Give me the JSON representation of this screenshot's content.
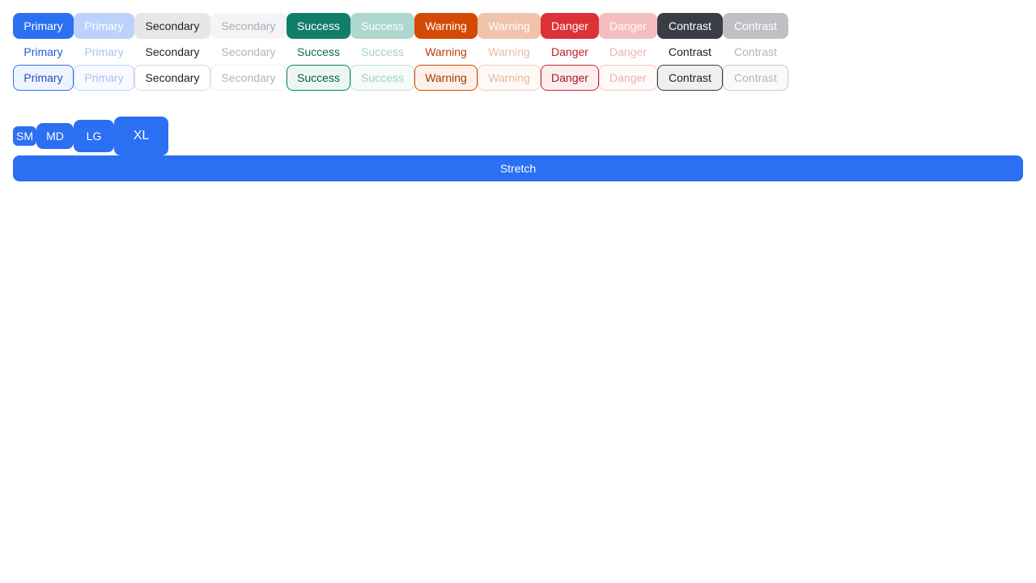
{
  "rows": {
    "filled": [
      {
        "label": "Primary",
        "variant": "primary",
        "disabled": false
      },
      {
        "label": "Primary",
        "variant": "primary",
        "disabled": true
      },
      {
        "label": "Secondary",
        "variant": "secondary",
        "disabled": false
      },
      {
        "label": "Secondary",
        "variant": "secondary",
        "disabled": true
      },
      {
        "label": "Success",
        "variant": "success",
        "disabled": false
      },
      {
        "label": "Success",
        "variant": "success",
        "disabled": true
      },
      {
        "label": "Warning",
        "variant": "warning",
        "disabled": false
      },
      {
        "label": "Warning",
        "variant": "warning",
        "disabled": true
      },
      {
        "label": "Danger",
        "variant": "danger",
        "disabled": false
      },
      {
        "label": "Danger",
        "variant": "danger",
        "disabled": true
      },
      {
        "label": "Contrast",
        "variant": "contrast",
        "disabled": false
      },
      {
        "label": "Contrast",
        "variant": "contrast",
        "disabled": true
      }
    ],
    "ghost": [
      {
        "label": "Primary",
        "variant": "primary",
        "disabled": false
      },
      {
        "label": "Primary",
        "variant": "primary",
        "disabled": true
      },
      {
        "label": "Secondary",
        "variant": "secondary",
        "disabled": false
      },
      {
        "label": "Secondary",
        "variant": "secondary",
        "disabled": true
      },
      {
        "label": "Success",
        "variant": "success",
        "disabled": false
      },
      {
        "label": "Success",
        "variant": "success",
        "disabled": true
      },
      {
        "label": "Warning",
        "variant": "warning",
        "disabled": false
      },
      {
        "label": "Warning",
        "variant": "warning",
        "disabled": true
      },
      {
        "label": "Danger",
        "variant": "danger",
        "disabled": false
      },
      {
        "label": "Danger",
        "variant": "danger",
        "disabled": true
      },
      {
        "label": "Contrast",
        "variant": "contrast",
        "disabled": false
      },
      {
        "label": "Contrast",
        "variant": "contrast",
        "disabled": true
      }
    ],
    "outline": [
      {
        "label": "Primary",
        "variant": "primary",
        "disabled": false
      },
      {
        "label": "Primary",
        "variant": "primary",
        "disabled": true
      },
      {
        "label": "Secondary",
        "variant": "secondary",
        "disabled": false
      },
      {
        "label": "Secondary",
        "variant": "secondary",
        "disabled": true
      },
      {
        "label": "Success",
        "variant": "success",
        "disabled": false
      },
      {
        "label": "Success",
        "variant": "success",
        "disabled": true
      },
      {
        "label": "Warning",
        "variant": "warning",
        "disabled": false
      },
      {
        "label": "Warning",
        "variant": "warning",
        "disabled": true
      },
      {
        "label": "Danger",
        "variant": "danger",
        "disabled": false
      },
      {
        "label": "Danger",
        "variant": "danger",
        "disabled": true
      },
      {
        "label": "Contrast",
        "variant": "contrast",
        "disabled": false
      },
      {
        "label": "Contrast",
        "variant": "contrast",
        "disabled": true
      }
    ]
  },
  "sizes": {
    "sm": "SM",
    "md": "MD",
    "lg": "LG",
    "xl": "XL"
  },
  "stretch_label": "Stretch",
  "colors": {
    "primary": "#2b6ff2",
    "secondary": "#e7e7ea",
    "success": "#117e6a",
    "warning": "#d44a05",
    "danger": "#dd3138",
    "contrast": "#3b3d46"
  }
}
